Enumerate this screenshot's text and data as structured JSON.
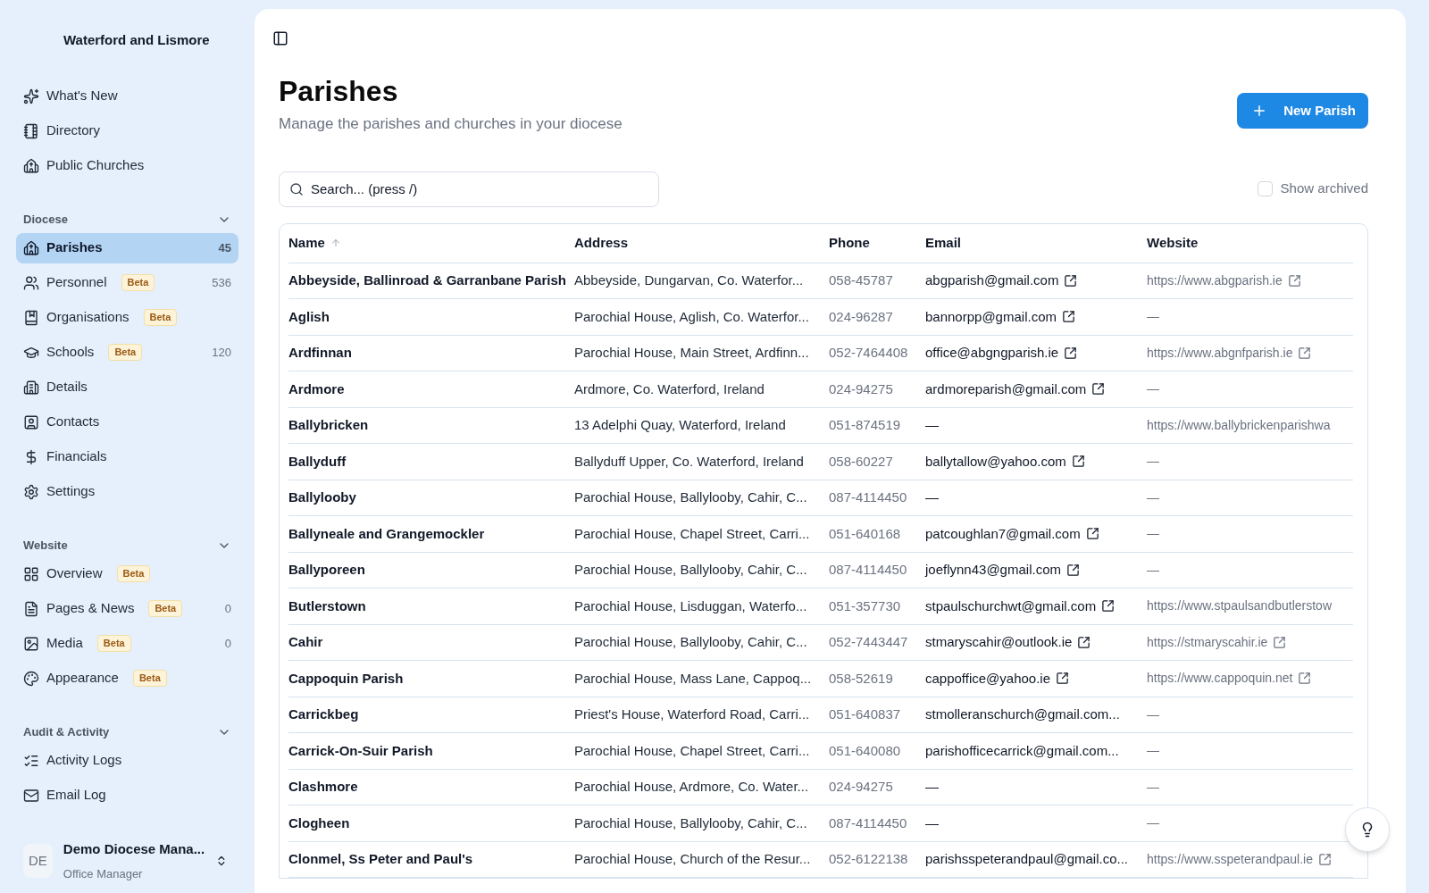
{
  "sidebar": {
    "org_name": "Waterford and Lismore",
    "top_items": [
      {
        "label": "What's New",
        "selected": false
      },
      {
        "label": "Directory",
        "selected": false
      },
      {
        "label": "Public Churches",
        "selected": false
      }
    ],
    "sections": [
      {
        "title": "Diocese",
        "expanded": true,
        "items": [
          {
            "label": "Parishes",
            "selected": true,
            "count": "45"
          },
          {
            "label": "Personnel",
            "selected": false,
            "badge": "Beta",
            "count": "536"
          },
          {
            "label": "Organisations",
            "selected": false,
            "badge": "Beta"
          },
          {
            "label": "Schools",
            "selected": false,
            "badge": "Beta",
            "count": "120"
          },
          {
            "label": "Details",
            "selected": false
          },
          {
            "label": "Contacts",
            "selected": false
          },
          {
            "label": "Financials",
            "selected": false
          },
          {
            "label": "Settings",
            "selected": false
          }
        ]
      },
      {
        "title": "Website",
        "expanded": true,
        "items": [
          {
            "label": "Overview",
            "selected": false,
            "badge": "Beta"
          },
          {
            "label": "Pages & News",
            "selected": false,
            "badge": "Beta",
            "count": "0"
          },
          {
            "label": "Media",
            "selected": false,
            "badge": "Beta",
            "count": "0"
          },
          {
            "label": "Appearance",
            "selected": false,
            "badge": "Beta"
          }
        ]
      },
      {
        "title": "Audit & Activity",
        "expanded": true,
        "items": [
          {
            "label": "Activity Logs",
            "selected": false
          },
          {
            "label": "Email Log",
            "selected": false
          }
        ]
      }
    ],
    "user": {
      "initials": "DE",
      "name": "Demo Diocese Mana...",
      "role": "Office Manager"
    }
  },
  "page": {
    "title": "Parishes",
    "subtitle": "Manage the parishes and churches in your diocese",
    "new_button": "New Parish",
    "search": {
      "placeholder": "Search... (press /)"
    },
    "show_archived": {
      "label": "Show archived",
      "checked": false
    }
  },
  "table": {
    "columns": [
      {
        "label": "Name",
        "sorted": true
      },
      {
        "label": "Address",
        "sorted": false
      },
      {
        "label": "Phone",
        "sorted": false
      },
      {
        "label": "Email",
        "sorted": false
      },
      {
        "label": "Website",
        "sorted": false
      }
    ],
    "rows": [
      {
        "name": "Abbeyside, Ballinroad & Garranbane Parish",
        "address": "Abbeyside, Dungarvan, Co. Waterfor...",
        "phone": "058-45787",
        "email": {
          "text": "abgparish@gmail.com",
          "link": true
        },
        "website": {
          "text": "https://www.abgparish.ie",
          "link": true
        }
      },
      {
        "name": "Aglish",
        "address": "Parochial House, Aglish, Co. Waterfor...",
        "phone": "024-96287",
        "email": {
          "text": "bannorpp@gmail.com",
          "link": true
        },
        "website": {
          "text": "—",
          "link": false
        }
      },
      {
        "name": "Ardfinnan",
        "address": "Parochial House, Main Street, Ardfinn...",
        "phone": "052-7464408",
        "email": {
          "text": "office@abgngparish.ie",
          "link": true
        },
        "website": {
          "text": "https://www.abgnfparish.ie",
          "link": true
        }
      },
      {
        "name": "Ardmore",
        "address": "Ardmore, Co. Waterford, Ireland",
        "phone": "024-94275",
        "email": {
          "text": "ardmoreparish@gmail.com",
          "link": true
        },
        "website": {
          "text": "—",
          "link": false
        }
      },
      {
        "name": "Ballybricken",
        "address": "13 Adelphi Quay, Waterford, Ireland",
        "phone": "051-874519",
        "email": {
          "text": "—",
          "link": false
        },
        "website": {
          "text": "https://www.ballybrickenparishwa",
          "link": false
        }
      },
      {
        "name": "Ballyduff",
        "address": "Ballyduff Upper, Co. Waterford, Ireland",
        "phone": "058-60227",
        "email": {
          "text": "ballytallow@yahoo.com",
          "link": true
        },
        "website": {
          "text": "—",
          "link": false
        }
      },
      {
        "name": "Ballylooby",
        "address": "Parochial House, Ballylooby, Cahir, C...",
        "phone": "087-4114450",
        "email": {
          "text": "—",
          "link": false
        },
        "website": {
          "text": "—",
          "link": false
        }
      },
      {
        "name": "Ballyneale and Grangemockler",
        "address": "Parochial House, Chapel Street, Carri...",
        "phone": "051-640168",
        "email": {
          "text": "patcoughlan7@gmail.com",
          "link": true
        },
        "website": {
          "text": "—",
          "link": false
        }
      },
      {
        "name": "Ballyporeen",
        "address": "Parochial House, Ballylooby, Cahir, C...",
        "phone": "087-4114450",
        "email": {
          "text": "joeflynn43@gmail.com",
          "link": true
        },
        "website": {
          "text": "—",
          "link": false
        }
      },
      {
        "name": "Butlerstown",
        "address": "Parochial House, Lisduggan, Waterfo...",
        "phone": "051-357730",
        "email": {
          "text": "stpaulschurchwt@gmail.com",
          "link": true
        },
        "website": {
          "text": "https://www.stpaulsandbutlerstow",
          "link": false
        }
      },
      {
        "name": "Cahir",
        "address": "Parochial House, Ballylooby, Cahir, C...",
        "phone": "052-7443447",
        "email": {
          "text": "stmaryscahir@outlook.ie",
          "link": true
        },
        "website": {
          "text": "https://stmaryscahir.ie",
          "link": true
        }
      },
      {
        "name": "Cappoquin Parish",
        "address": "Parochial House, Mass Lane, Cappoq...",
        "phone": "058-52619",
        "email": {
          "text": "cappoffice@yahoo.ie",
          "link": true
        },
        "website": {
          "text": "https://www.cappoquin.net",
          "link": true
        }
      },
      {
        "name": "Carrickbeg",
        "address": "Priest's House, Waterford Road, Carri...",
        "phone": "051-640837",
        "email": {
          "text": "stmolleranschurch@gmail.com...",
          "link": false
        },
        "website": {
          "text": "—",
          "link": false
        }
      },
      {
        "name": "Carrick-On-Suir Parish",
        "address": "Parochial House, Chapel Street, Carri...",
        "phone": "051-640080",
        "email": {
          "text": "parishofficecarrick@gmail.com...",
          "link": false
        },
        "website": {
          "text": "—",
          "link": false
        }
      },
      {
        "name": "Clashmore",
        "address": "Parochial House, Ardmore, Co. Water...",
        "phone": "024-94275",
        "email": {
          "text": "—",
          "link": false
        },
        "website": {
          "text": "—",
          "link": false
        }
      },
      {
        "name": "Clogheen",
        "address": "Parochial House, Ballylooby, Cahir, C...",
        "phone": "087-4114450",
        "email": {
          "text": "—",
          "link": false
        },
        "website": {
          "text": "—",
          "link": false
        }
      },
      {
        "name": "Clonmel, Ss Peter and Paul's",
        "address": "Parochial House, Church of the Resur...",
        "phone": "052-6122138",
        "email": {
          "text": "parishsspeterandpaul@gmail.co...",
          "link": false
        },
        "website": {
          "text": "https://www.sspeterandpaul.ie",
          "link": true
        }
      }
    ]
  }
}
